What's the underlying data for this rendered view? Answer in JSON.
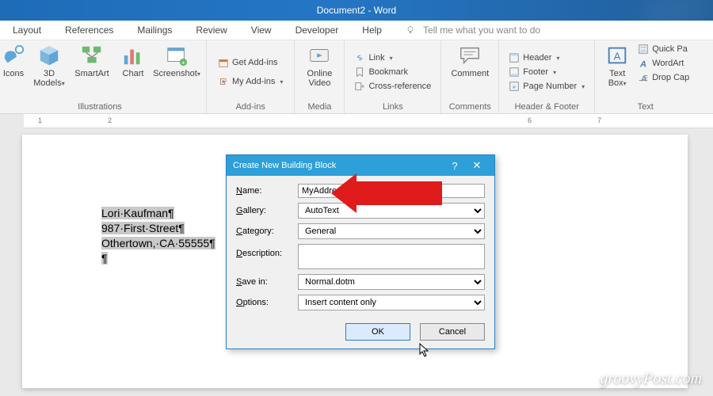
{
  "title": "Document2 - Word",
  "tabs": {
    "layout": "Layout",
    "references": "References",
    "mailings": "Mailings",
    "review": "Review",
    "view": "View",
    "developer": "Developer",
    "help": "Help",
    "tell": "Tell me what you want to do"
  },
  "ribbon": {
    "illustrations": {
      "label": "Illustrations",
      "icons": "Icons",
      "models": "3D\nModels",
      "smartart": "SmartArt",
      "chart": "Chart",
      "screenshot": "Screenshot"
    },
    "addins": {
      "label": "Add-ins",
      "get": "Get Add-ins",
      "my": "My Add-ins"
    },
    "media": {
      "label": "Media",
      "video": "Online\nVideo"
    },
    "links": {
      "label": "Links",
      "link": "Link",
      "bookmark": "Bookmark",
      "cross": "Cross-reference"
    },
    "comments": {
      "label": "Comments",
      "comment": "Comment"
    },
    "headerfooter": {
      "label": "Header & Footer",
      "header": "Header",
      "footer": "Footer",
      "page": "Page Number"
    },
    "text": {
      "label": "Text",
      "textbox": "Text\nBox",
      "quick": "Quick Pa",
      "wordart": "WordArt",
      "drop": "Drop Cap"
    }
  },
  "ruler": {
    "m1": "1",
    "m2": "2",
    "m6": "6",
    "m7": "7"
  },
  "document": {
    "line1": "Lori·Kaufman¶",
    "line2": "987·First·Street¶",
    "line3": "Othertown,·CA·55555¶",
    "line4": "¶"
  },
  "dialog": {
    "title": "Create New Building Block",
    "help": "?",
    "close": "✕",
    "name_label": "Name:",
    "name_value": "MyAddress",
    "gallery_label": "Gallery:",
    "gallery_value": "AutoText",
    "category_label": "Category:",
    "category_value": "General",
    "desc_label": "Description:",
    "desc_value": "",
    "save_label": "Save in:",
    "save_value": "Normal.dotm",
    "options_label": "Options:",
    "options_value": "Insert content only",
    "ok": "OK",
    "cancel": "Cancel"
  },
  "watermark": "groovyPost.com"
}
